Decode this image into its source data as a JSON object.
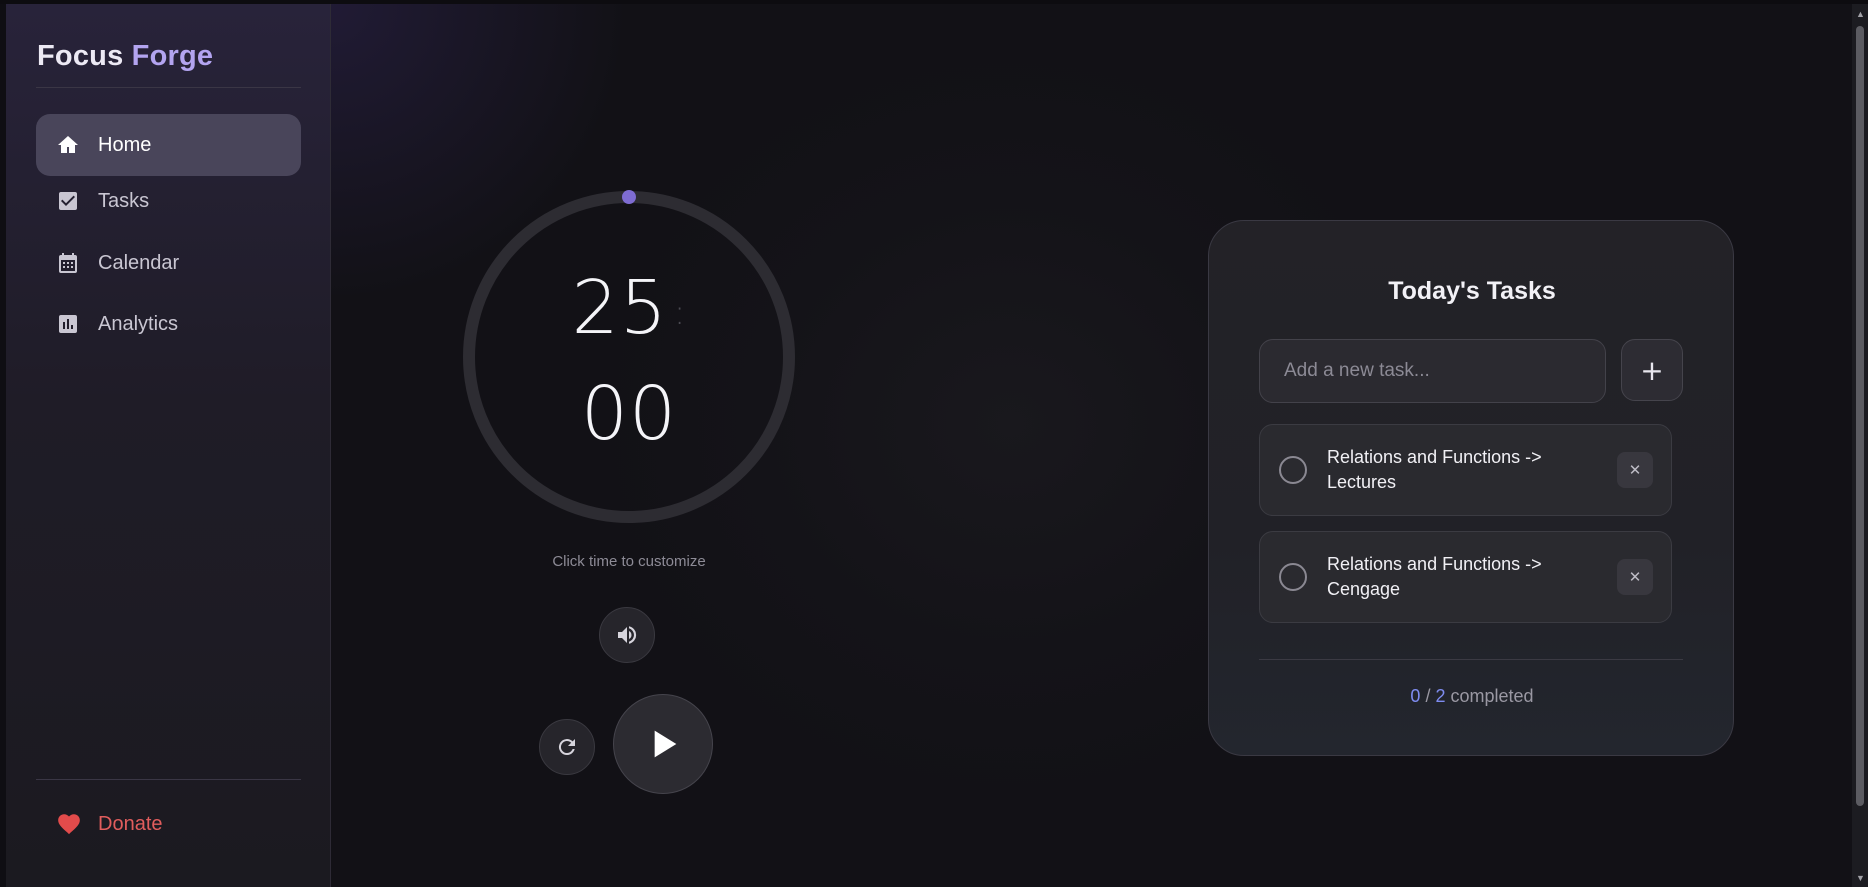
{
  "brand": {
    "part1": "Focus",
    "part2": "Forge"
  },
  "nav": {
    "items": [
      {
        "label": "Home",
        "icon": "home-icon",
        "active": true
      },
      {
        "label": "Tasks",
        "icon": "checkbox-icon",
        "active": false
      },
      {
        "label": "Calendar",
        "icon": "calendar-icon",
        "active": false
      },
      {
        "label": "Analytics",
        "icon": "analytics-icon",
        "active": false
      }
    ],
    "donate_label": "Donate"
  },
  "timer": {
    "minutes": "25",
    "seconds": "00",
    "separator": ":",
    "hint": "Click time to customize",
    "progress": 0
  },
  "tasks_panel": {
    "title": "Today's Tasks",
    "input_placeholder": "Add a new task...",
    "add_label": "+",
    "items": [
      {
        "text": "Relations and Functions -> Lectures",
        "done": false
      },
      {
        "text": "Relations and Functions -> Cengage",
        "done": false
      }
    ],
    "completed": "0",
    "total": "2",
    "completed_sep": "/",
    "completed_label": "completed"
  },
  "colors": {
    "accent": "#7e6cd2",
    "brand_secondary": "#b3a4f0",
    "donate": "#e15d5d",
    "count": "#7e8cf0"
  }
}
